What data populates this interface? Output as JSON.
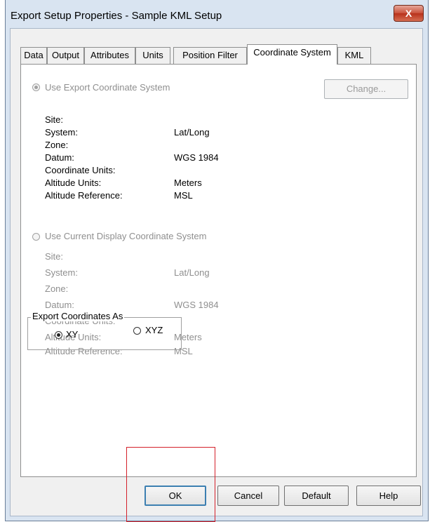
{
  "window": {
    "title": "Export Setup Properties - Sample KML Setup",
    "close_label": "X"
  },
  "tabs": [
    {
      "label": "Data"
    },
    {
      "label": "Output"
    },
    {
      "label": "Attributes"
    },
    {
      "label": "Units"
    },
    {
      "label": "Position Filter"
    },
    {
      "label": "Coordinate System",
      "active": true
    },
    {
      "label": "KML"
    }
  ],
  "export_coord": {
    "radio_label": "Use Export Coordinate System",
    "selected": true,
    "change_button": "Change...",
    "fields": [
      {
        "label": "Site:",
        "value": ""
      },
      {
        "label": "System:",
        "value": "Lat/Long"
      },
      {
        "label": "Zone:",
        "value": ""
      },
      {
        "label": "Datum:",
        "value": "WGS 1984"
      },
      {
        "label": "Coordinate Units:",
        "value": ""
      },
      {
        "label": "Altitude Units:",
        "value": "Meters"
      },
      {
        "label": "Altitude Reference:",
        "value": "MSL"
      }
    ]
  },
  "display_coord": {
    "radio_label": "Use Current Display Coordinate System",
    "selected": false,
    "fields": [
      {
        "label": "Site:",
        "value": ""
      },
      {
        "label": "System:",
        "value": "Lat/Long"
      },
      {
        "label": "Zone:",
        "value": ""
      },
      {
        "label": "Datum:",
        "value": "WGS 1984"
      },
      {
        "label": "Coordinate Units:",
        "value": ""
      },
      {
        "label": "Altitude Units:",
        "value": "Meters"
      },
      {
        "label": "Altitude Reference:",
        "value": "MSL"
      }
    ]
  },
  "export_as": {
    "group_label": "Export Coordinates As",
    "options": [
      {
        "label": "XY",
        "selected": true
      },
      {
        "label": "XYZ",
        "selected": false
      }
    ]
  },
  "buttons": {
    "ok": "OK",
    "cancel": "Cancel",
    "default": "Default",
    "help": "Help"
  },
  "colors": {
    "highlight_box": "#d4202a",
    "window_frame": "#d9e4f1",
    "close_button": "#c9503a"
  }
}
